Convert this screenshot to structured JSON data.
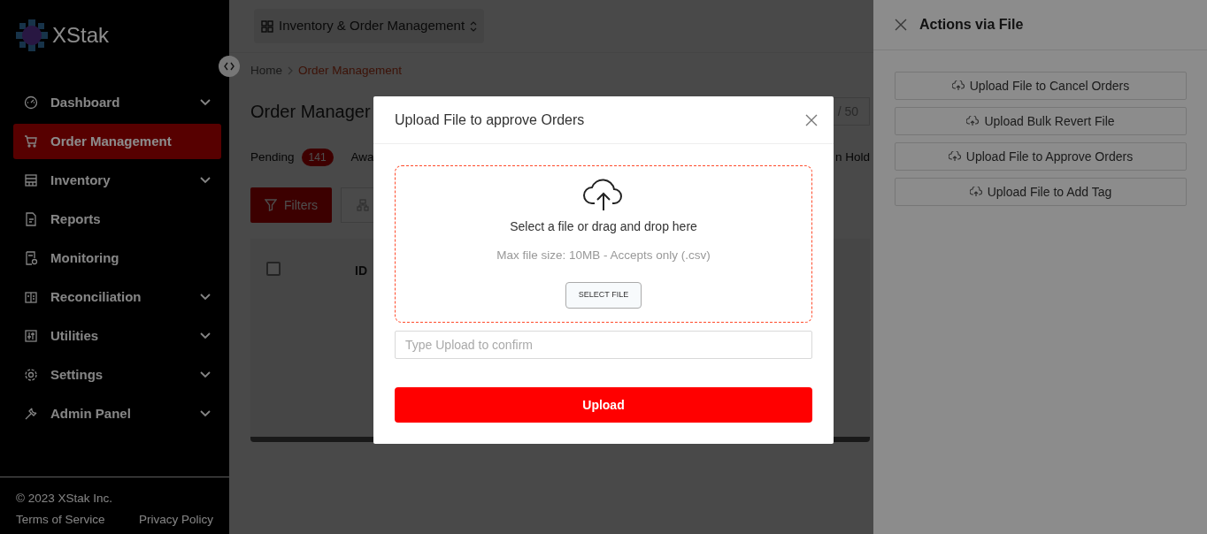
{
  "sidebar": {
    "logo": "XStak",
    "items": [
      {
        "label": "Dashboard",
        "expandable": true,
        "selected": false
      },
      {
        "label": "Order Management",
        "expandable": false,
        "selected": true
      },
      {
        "label": "Inventory",
        "expandable": true,
        "selected": false
      },
      {
        "label": "Reports",
        "expandable": false,
        "selected": false
      },
      {
        "label": "Monitoring",
        "expandable": false,
        "selected": false
      },
      {
        "label": "Reconciliation",
        "expandable": true,
        "selected": false
      },
      {
        "label": "Utilities",
        "expandable": true,
        "selected": false
      },
      {
        "label": "Settings",
        "expandable": true,
        "selected": false
      },
      {
        "label": "Admin Panel",
        "expandable": true,
        "selected": false
      }
    ],
    "copyright": "© 2023 XStak Inc.",
    "links": [
      "Terms of Service",
      "Privacy Policy"
    ]
  },
  "header": {
    "workspace": "Inventory & Order Management"
  },
  "breadcrumb": [
    {
      "label": "Home",
      "current": false
    },
    {
      "label": "Order Management",
      "current": true
    }
  ],
  "page_title": "Order Manager",
  "pagination": {
    "text": "/ 50"
  },
  "tabs": [
    {
      "label": "Pending",
      "count": "141"
    },
    {
      "label": "Awa"
    },
    {
      "label": "n Hold"
    }
  ],
  "toolbar": {
    "filters": "Filters"
  },
  "table": {
    "select_all_checked": false,
    "columns": [
      "ID"
    ]
  },
  "drawer": {
    "title": "Actions via File",
    "actions": [
      "Upload File to Cancel Orders",
      "Upload Bulk Revert File",
      "Upload File to Approve Orders",
      "Upload File to Add Tag"
    ]
  },
  "modal": {
    "title": "Upload File to approve Orders",
    "drop_text": "Select a file or drag and drop here",
    "hint": "Max file size: 10MB - Accepts only (.csv)",
    "select_button": "SELECT FILE",
    "confirm_placeholder": "Type Upload to confirm",
    "submit": "Upload"
  }
}
